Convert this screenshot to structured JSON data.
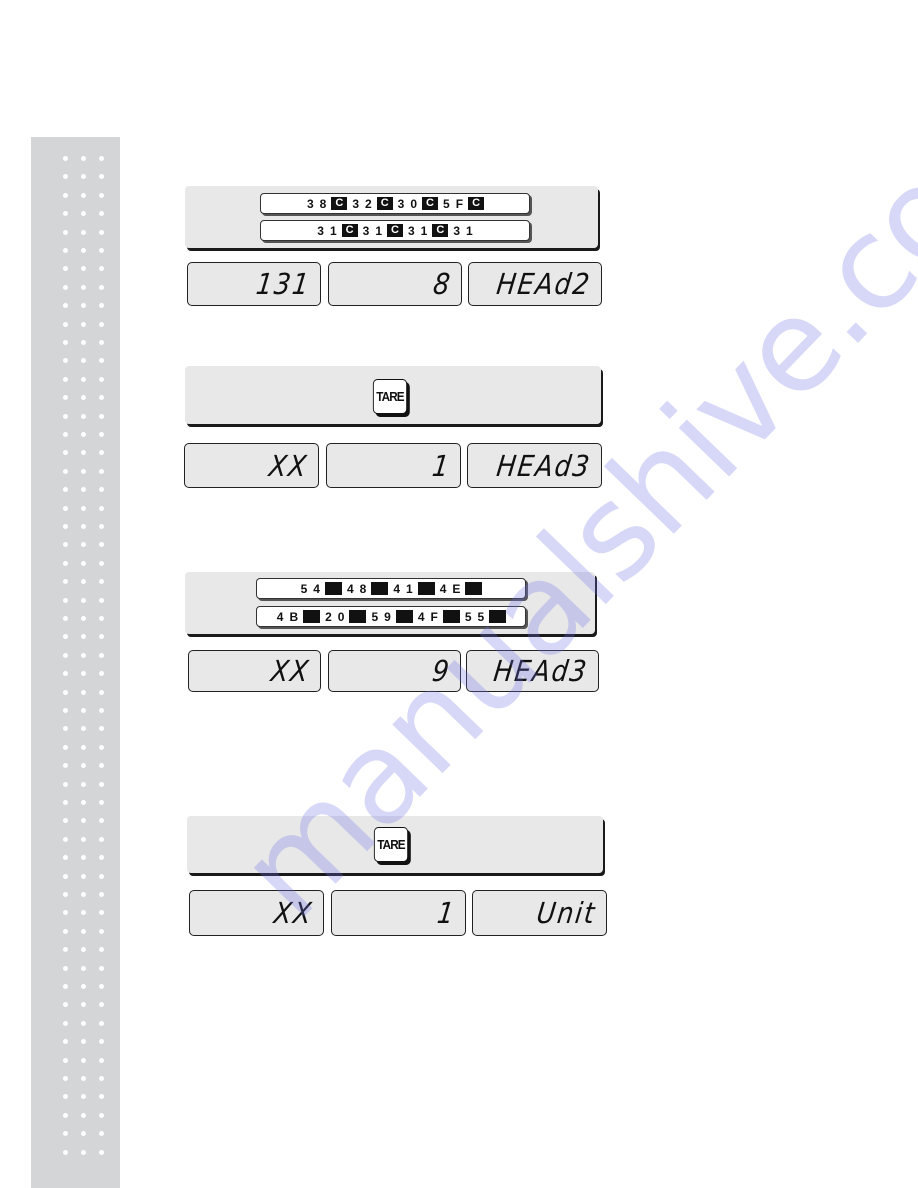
{
  "sidebar": {
    "dot_columns": 3,
    "dot_rows": 55
  },
  "steps": [
    {
      "type": "code-strips",
      "strips": [
        [
          {
            "t": "3 8"
          },
          {
            "b": "C"
          },
          {
            "t": "3 2"
          },
          {
            "b": "C"
          },
          {
            "t": "3 0"
          },
          {
            "b": "C"
          },
          {
            "t": "5 F"
          },
          {
            "b": "C"
          }
        ],
        [
          {
            "t": "3 1"
          },
          {
            "b": "C"
          },
          {
            "t": "3 1"
          },
          {
            "b": "C"
          },
          {
            "t": "3 1"
          },
          {
            "b": "C"
          },
          {
            "t": "3 1"
          }
        ]
      ],
      "displays": [
        "131",
        "8",
        "HEAd2"
      ]
    },
    {
      "type": "key",
      "key_label": "TARE",
      "displays": [
        "XX",
        "1",
        "HEAd3"
      ]
    },
    {
      "type": "code-strips",
      "strips": [
        [
          {
            "t": "5 4"
          },
          {
            "b": ""
          },
          {
            "t": "4 8"
          },
          {
            "b": ""
          },
          {
            "t": "4 1"
          },
          {
            "b": ""
          },
          {
            "t": "4 E"
          },
          {
            "b": ""
          }
        ],
        [
          {
            "t": "4 B"
          },
          {
            "b": ""
          },
          {
            "t": "2 0"
          },
          {
            "b": ""
          },
          {
            "t": "5 9"
          },
          {
            "b": ""
          },
          {
            "t": "4 F"
          },
          {
            "b": ""
          },
          {
            "t": "5 5"
          },
          {
            "b": ""
          }
        ]
      ],
      "displays": [
        "XX",
        "9",
        "HEAd3"
      ]
    },
    {
      "type": "key",
      "key_label": "TARE",
      "displays": [
        "XX",
        "1",
        "Unit"
      ]
    }
  ],
  "watermark": "manualshive.com"
}
